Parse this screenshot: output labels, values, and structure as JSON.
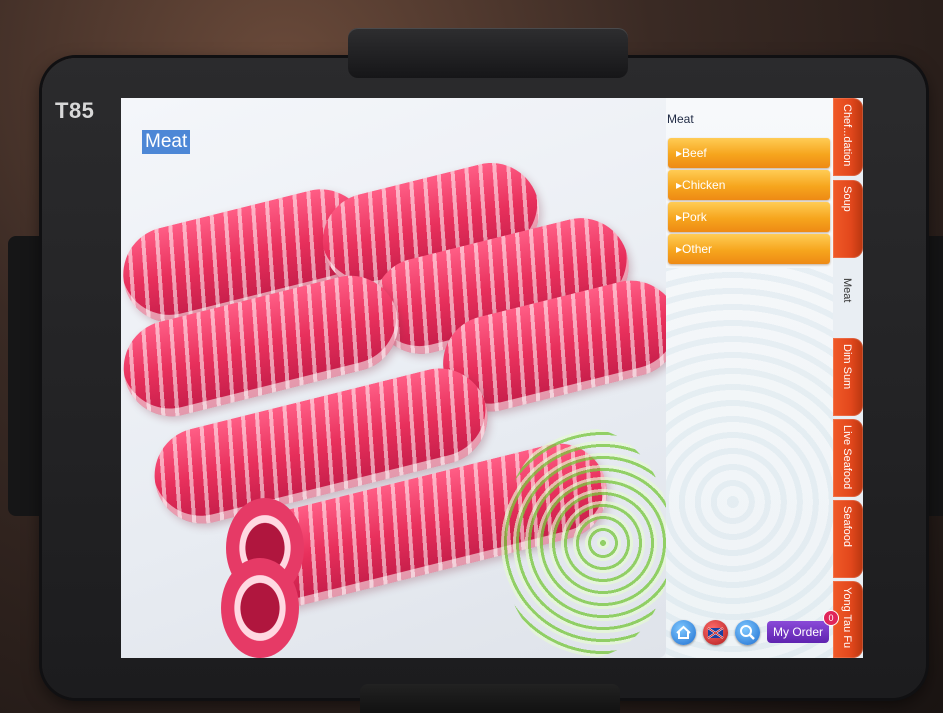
{
  "device": {
    "table_label": "T85"
  },
  "photo": {
    "title": "Meat"
  },
  "menu": {
    "title": "Meat",
    "categories": [
      {
        "label": "▸Beef"
      },
      {
        "label": "▸Chicken"
      },
      {
        "label": "▸Pork"
      },
      {
        "label": "▸Other"
      }
    ]
  },
  "side_tabs": [
    {
      "label": "Chef...dation"
    },
    {
      "label": "Soup"
    },
    {
      "label": "Meat",
      "active": true
    },
    {
      "label": "Dim Sum"
    },
    {
      "label": "Live Seafood"
    },
    {
      "label": "Seafood"
    },
    {
      "label": "Yong Tau Fu"
    }
  ],
  "bottom_bar": {
    "home_icon": "home-icon",
    "language_icon": "language-flag-icon",
    "search_icon": "search-icon",
    "order_label": "My Order",
    "order_count": "0"
  },
  "colors": {
    "category_button": "#f6a51d",
    "tab": "#e2471c",
    "order_button": "#6a2fc0",
    "title_highlight": "#4d87d6"
  }
}
